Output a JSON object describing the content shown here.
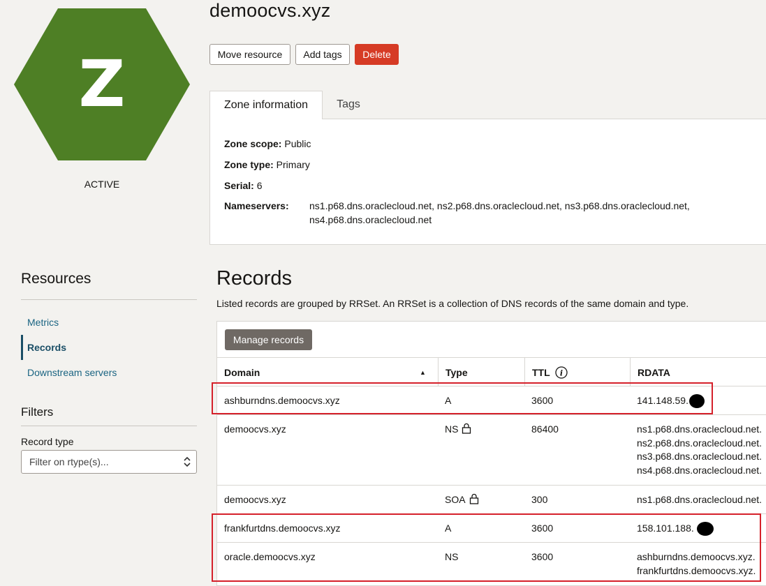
{
  "zone": {
    "avatar_letter": "Z",
    "avatar_color": "#4e7f25",
    "status": "ACTIVE",
    "name": "demoocvs.xyz"
  },
  "actions": {
    "move": "Move resource",
    "tags": "Add tags",
    "delete": "Delete"
  },
  "tabs": [
    {
      "label": "Zone information",
      "active": true
    },
    {
      "label": "Tags",
      "active": false
    }
  ],
  "info": {
    "scope_label": "Zone scope:",
    "scope_value": "Public",
    "type_label": "Zone type:",
    "type_value": "Primary",
    "serial_label": "Serial:",
    "serial_value": "6",
    "ns_label": "Nameservers:",
    "ns_line1": "ns1.p68.dns.oraclecloud.net, ns2.p68.dns.oraclecloud.net, ns3.p68.dns.oraclecloud.net,",
    "ns_line2": "ns4.p68.dns.oraclecloud.net"
  },
  "sidebar": {
    "resources_title": "Resources",
    "items": [
      {
        "label": "Metrics",
        "active": false
      },
      {
        "label": "Records",
        "active": true
      },
      {
        "label": "Downstream servers",
        "active": false
      }
    ],
    "filters_title": "Filters",
    "record_type_label": "Record type",
    "record_type_placeholder": "Filter on rtype(s)..."
  },
  "records": {
    "title": "Records",
    "description": "Listed records are grouped by RRSet. An RRSet is a collection of DNS records of the same domain and type.",
    "manage_button": "Manage records",
    "columns": [
      "Domain",
      "Type",
      "TTL",
      "RDATA"
    ],
    "rows": [
      {
        "domain": "ashburndns.demoocvs.xyz",
        "type": "A",
        "locked": false,
        "ttl": "3600",
        "rdata": [
          "141.148.59."
        ]
      },
      {
        "domain": "demoocvs.xyz",
        "type": "NS",
        "locked": true,
        "ttl": "86400",
        "rdata": [
          "ns1.p68.dns.oraclecloud.net.",
          "ns2.p68.dns.oraclecloud.net.",
          "ns3.p68.dns.oraclecloud.net.",
          "ns4.p68.dns.oraclecloud.net."
        ]
      },
      {
        "domain": "demoocvs.xyz",
        "type": "SOA",
        "locked": true,
        "ttl": "300",
        "rdata": [
          "ns1.p68.dns.oraclecloud.net."
        ]
      },
      {
        "domain": "frankfurtdns.demoocvs.xyz",
        "type": "A",
        "locked": false,
        "ttl": "3600",
        "rdata": [
          "158.101.188."
        ]
      },
      {
        "domain": "oracle.demoocvs.xyz",
        "type": "NS",
        "locked": false,
        "ttl": "3600",
        "rdata": [
          "ashburndns.demoocvs.xyz.",
          "frankfurtdns.demoocvs.xyz."
        ]
      }
    ]
  },
  "colors": {
    "accent_link": "#1a6482",
    "delete": "#d63b25",
    "highlight": "#d5202a"
  }
}
